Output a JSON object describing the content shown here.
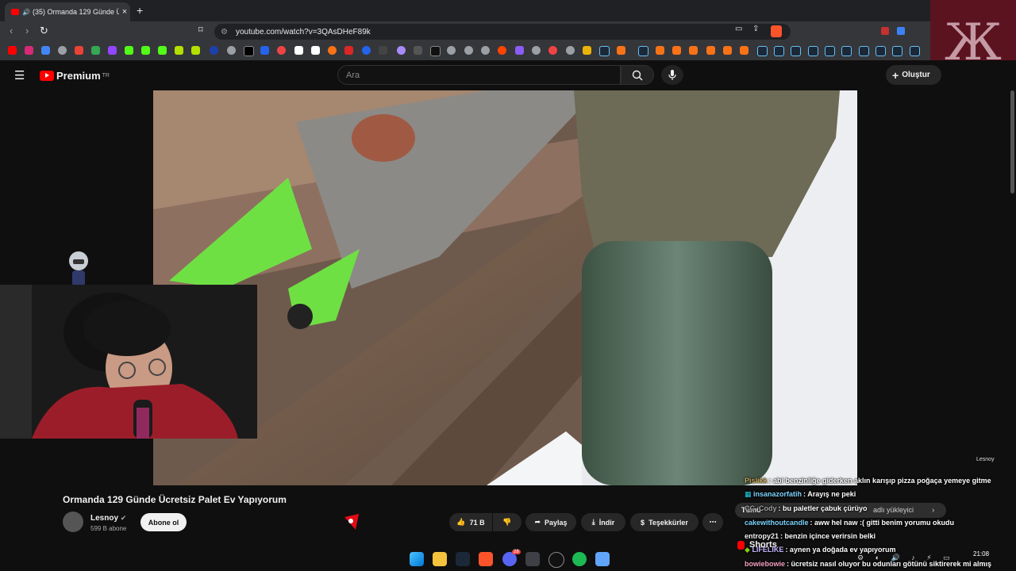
{
  "browser": {
    "tab_title": "(35) Ormanda 129 Günde Üc",
    "url": "youtube.com/watch?v=3QAsDHeF89k"
  },
  "youtube": {
    "logo_text": "Premium",
    "logo_region": "TR",
    "search_placeholder": "Ara",
    "create_label": "Oluştur"
  },
  "video": {
    "title": "Ormanda 129 Günde Ücretsiz Palet Ev Yapıyorum",
    "watermark": "Lesnoy",
    "channel_name": "Lesnoy",
    "subscribers": "599 B abone",
    "subscribe_label": "Abone ol",
    "likes": "71 B",
    "share_label": "Paylaş",
    "download_label": "İndir",
    "thanks_label": "Teşekkürler",
    "more_label": "⋯"
  },
  "chat": {
    "lines": [
      {
        "user": "Pislikk",
        "text": ": abi benzinliğe giderken aklın karışıp pizza poğaça yemeye gitme",
        "color": "#c7a95a"
      },
      {
        "user": "insanazorfatih",
        "text": ": Arayış ne peki",
        "color": "#7dd3fc"
      },
      {
        "user": "CC_Cody",
        "text": ": bu paletler çabuk çürüyo",
        "color": "#a3a3a3"
      },
      {
        "user": "cakewithoutcandle",
        "text": ": aww hel naw :( gitti benim yorumu okudu",
        "color": "#7dd3fc"
      },
      {
        "user": "entropy21",
        "text": ": benzin içince verirsin belki",
        "color": "#f1f1f1"
      },
      {
        "user": "LIFELIKE",
        "text": ": aynen ya doğada ev yapıyorum",
        "color": "#c4b5fd"
      },
      {
        "user": "bowiebowie",
        "text": ": ücretsiz nasıl oluyor bu odunları götünü siktirerek mi almış",
        "color": "#f5a0c0"
      }
    ],
    "chip_left": "Tümü",
    "chip_text": "adlı yükleyici",
    "shorts_label": "Shorts"
  },
  "taskbar": {
    "time": "21:08",
    "discord_badge": "28"
  },
  "colors": {
    "accent_red": "#ff0000",
    "background": "#0f0f0f"
  }
}
